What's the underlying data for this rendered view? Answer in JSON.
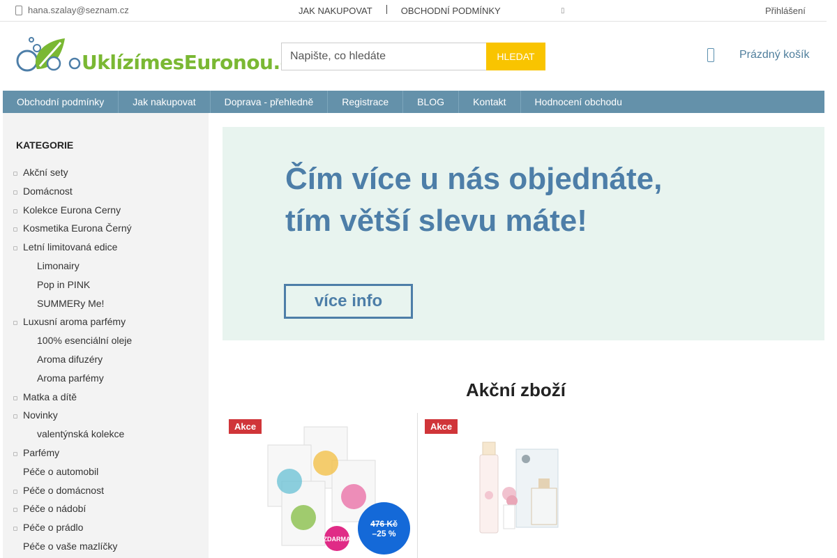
{
  "topbar": {
    "email": "hana.szalay@seznam.cz",
    "links": [
      "JAK NAKUPOVAT",
      "OBCHODNÍ PODMÍNKY"
    ],
    "extra": "▯",
    "login": "Přihlášení"
  },
  "header": {
    "logo_text": "UklízímesEuronou.cz",
    "search": {
      "placeholder": "Napište, co hledáte",
      "button": "HLEDAT"
    },
    "cart_label": "Prázdný košík"
  },
  "nav": {
    "items": [
      "Obchodní podmínky",
      "Jak nakupovat",
      "Doprava - přehledně",
      "Registrace",
      "BLOG",
      "Kontakt",
      "Hodnocení obchodu"
    ]
  },
  "sidebar": {
    "heading": "KATEGORIE",
    "items": [
      {
        "label": "Akční sety",
        "level": "top",
        "bullet": true
      },
      {
        "label": "Domácnost",
        "level": "top",
        "bullet": true
      },
      {
        "label": "Kolekce Eurona Cerny",
        "level": "top",
        "bullet": true
      },
      {
        "label": "Kosmetika Eurona Černý",
        "level": "top",
        "bullet": true
      },
      {
        "label": "Letní limitovaná edice",
        "level": "top",
        "bullet": true
      },
      {
        "label": "Limonairy",
        "level": "sub",
        "bullet": false
      },
      {
        "label": "Pop in PINK",
        "level": "sub",
        "bullet": false
      },
      {
        "label": "SUMMERy Me!",
        "level": "sub",
        "bullet": false
      },
      {
        "label": "Luxusní aroma parfémy",
        "level": "top",
        "bullet": true
      },
      {
        "label": "100% esenciální oleje",
        "level": "sub",
        "bullet": false
      },
      {
        "label": "Aroma difuzéry",
        "level": "sub",
        "bullet": false
      },
      {
        "label": "Aroma parfémy",
        "level": "sub",
        "bullet": false
      },
      {
        "label": "Matka a dítě",
        "level": "top",
        "bullet": true
      },
      {
        "label": "Novinky",
        "level": "top",
        "bullet": true
      },
      {
        "label": "valentýnská kolekce",
        "level": "sub",
        "bullet": false
      },
      {
        "label": "Parfémy",
        "level": "top",
        "bullet": true
      },
      {
        "label": "Péče o automobil",
        "level": "top",
        "bullet": false
      },
      {
        "label": "Péče o domácnost",
        "level": "top",
        "bullet": true
      },
      {
        "label": "Péče o nádobí",
        "level": "top",
        "bullet": true
      },
      {
        "label": "Péče o prádlo",
        "level": "top",
        "bullet": true
      },
      {
        "label": "Péče o vaše mazlíčky",
        "level": "top",
        "bullet": false
      }
    ]
  },
  "banner": {
    "line1": "Čím více u nás objednáte,",
    "line2": "tím větší slevu máte!",
    "button": "více info"
  },
  "section": {
    "title": "Akční zboží"
  },
  "products": [
    {
      "badge": "Akce",
      "old_price": "476 Kč",
      "discount": "–25 %",
      "image_badge": "ZDARMA"
    },
    {
      "badge": "Akce"
    }
  ],
  "colors": {
    "nav_bg": "#6491aa",
    "accent_yellow": "#f9c400",
    "brand_green": "#7ab833",
    "banner_text": "#4d7ea8",
    "badge_red": "#d03539",
    "discount_blue": "#1469d8"
  }
}
